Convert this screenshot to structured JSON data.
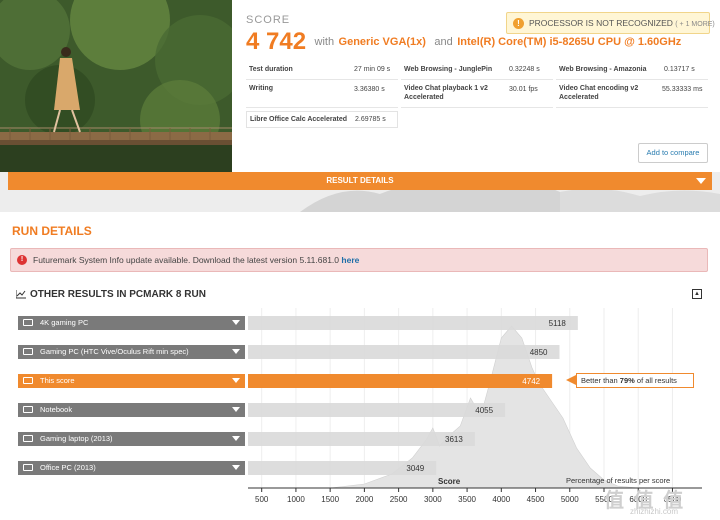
{
  "score": {
    "label": "SCORE",
    "value": "4 742",
    "with_text": "with",
    "gpu": "Generic VGA(1x)",
    "and_text": "and",
    "cpu": "Intel(R) Core(TM) i5-8265U CPU @ 1.60GHz"
  },
  "warning": {
    "text": "PROCESSOR IS NOT RECOGNIZED",
    "more": "( + 1 MORE)"
  },
  "stats": [
    {
      "label": "Test duration",
      "value": "27 min 09 s"
    },
    {
      "label": "Web Browsing - JunglePin",
      "value": "0.32248 s"
    },
    {
      "label": "Web Browsing - Amazonia",
      "value": "0.13717 s"
    },
    {
      "label": "Writing",
      "value": "3.36380 s"
    },
    {
      "label": "Video Chat playback 1 v2 Accelerated",
      "value": "30.01 fps"
    },
    {
      "label": "Video Chat encoding v2 Accelerated",
      "value": "55.33333 ms"
    },
    {
      "label": "Libre Office Calc Accelerated",
      "value": "2.69785 s"
    }
  ],
  "add_compare": "Add to compare",
  "result_details": "RESULT DETAILS",
  "run_details": {
    "title": "RUN DETAILS",
    "alert_text": "Futuremark System Info update available. Download the latest version 5.11.681.0",
    "alert_link": "here"
  },
  "other_results": {
    "title": "OTHER RESULTS IN PCMARK 8 RUN"
  },
  "chart_data": {
    "type": "bar",
    "orientation": "horizontal",
    "categories": [
      "4K gaming PC",
      "Gaming PC (HTC Vive/Oculus Rift min spec)",
      "This score",
      "Notebook",
      "Gaming laptop (2013)",
      "Office PC (2013)"
    ],
    "values": [
      5118,
      4850,
      4742,
      4055,
      3613,
      3049
    ],
    "highlight_index": 2,
    "xlabel": "Score",
    "distribution_label": "Percentage of results per score",
    "xticks": [
      500,
      1000,
      1500,
      2000,
      2500,
      3000,
      3500,
      4000,
      4500,
      5000,
      5500,
      6000,
      6500
    ],
    "xlim": [
      300,
      6800
    ],
    "better_than": {
      "prefix": "Better than",
      "percent": "79%",
      "suffix": "of all results"
    },
    "colors": {
      "highlight": "#f08a2e",
      "bar": "#d9d9d9",
      "label_bg": "#7a7a7a"
    }
  },
  "watermark": {
    "main": "值 值 值",
    "sub": "zhizhizhi.com"
  }
}
